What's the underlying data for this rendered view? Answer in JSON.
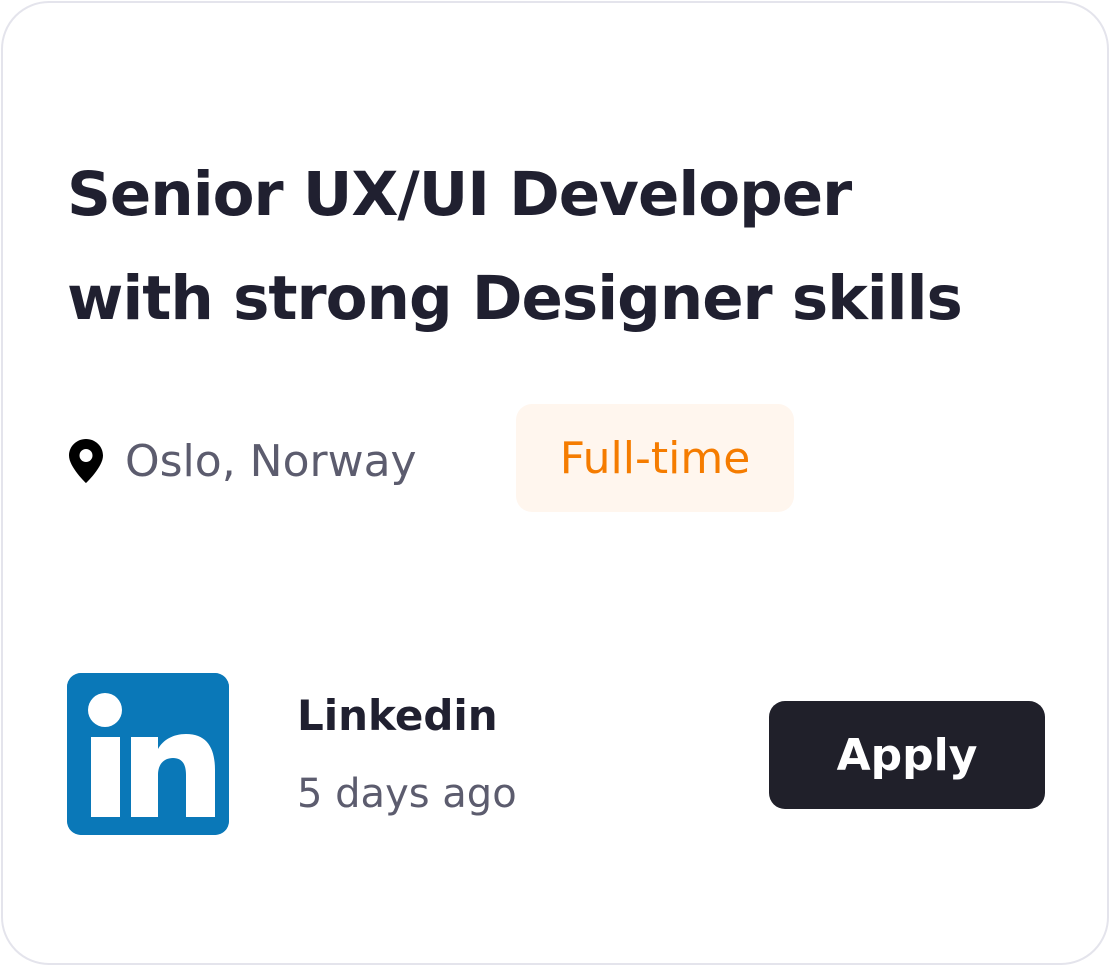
{
  "job": {
    "title_line1": "Senior UX/UI Developer",
    "title_line2": "with strong Designer skills",
    "location": "Oslo, Norway",
    "employment_type": "Full-time"
  },
  "company": {
    "name": "Linkedin",
    "logo_icon": "linkedin-icon",
    "posted": "5 days ago"
  },
  "actions": {
    "apply_label": "Apply"
  },
  "icons": {
    "location": "map-pin-icon"
  },
  "colors": {
    "title": "#202030",
    "muted_text": "#5c5c6e",
    "badge_text": "#f57c00",
    "badge_bg": "#fff6ee",
    "linkedin_blue": "#0a78b8",
    "button_bg": "#20202a",
    "card_border": "#e4e4ec"
  }
}
